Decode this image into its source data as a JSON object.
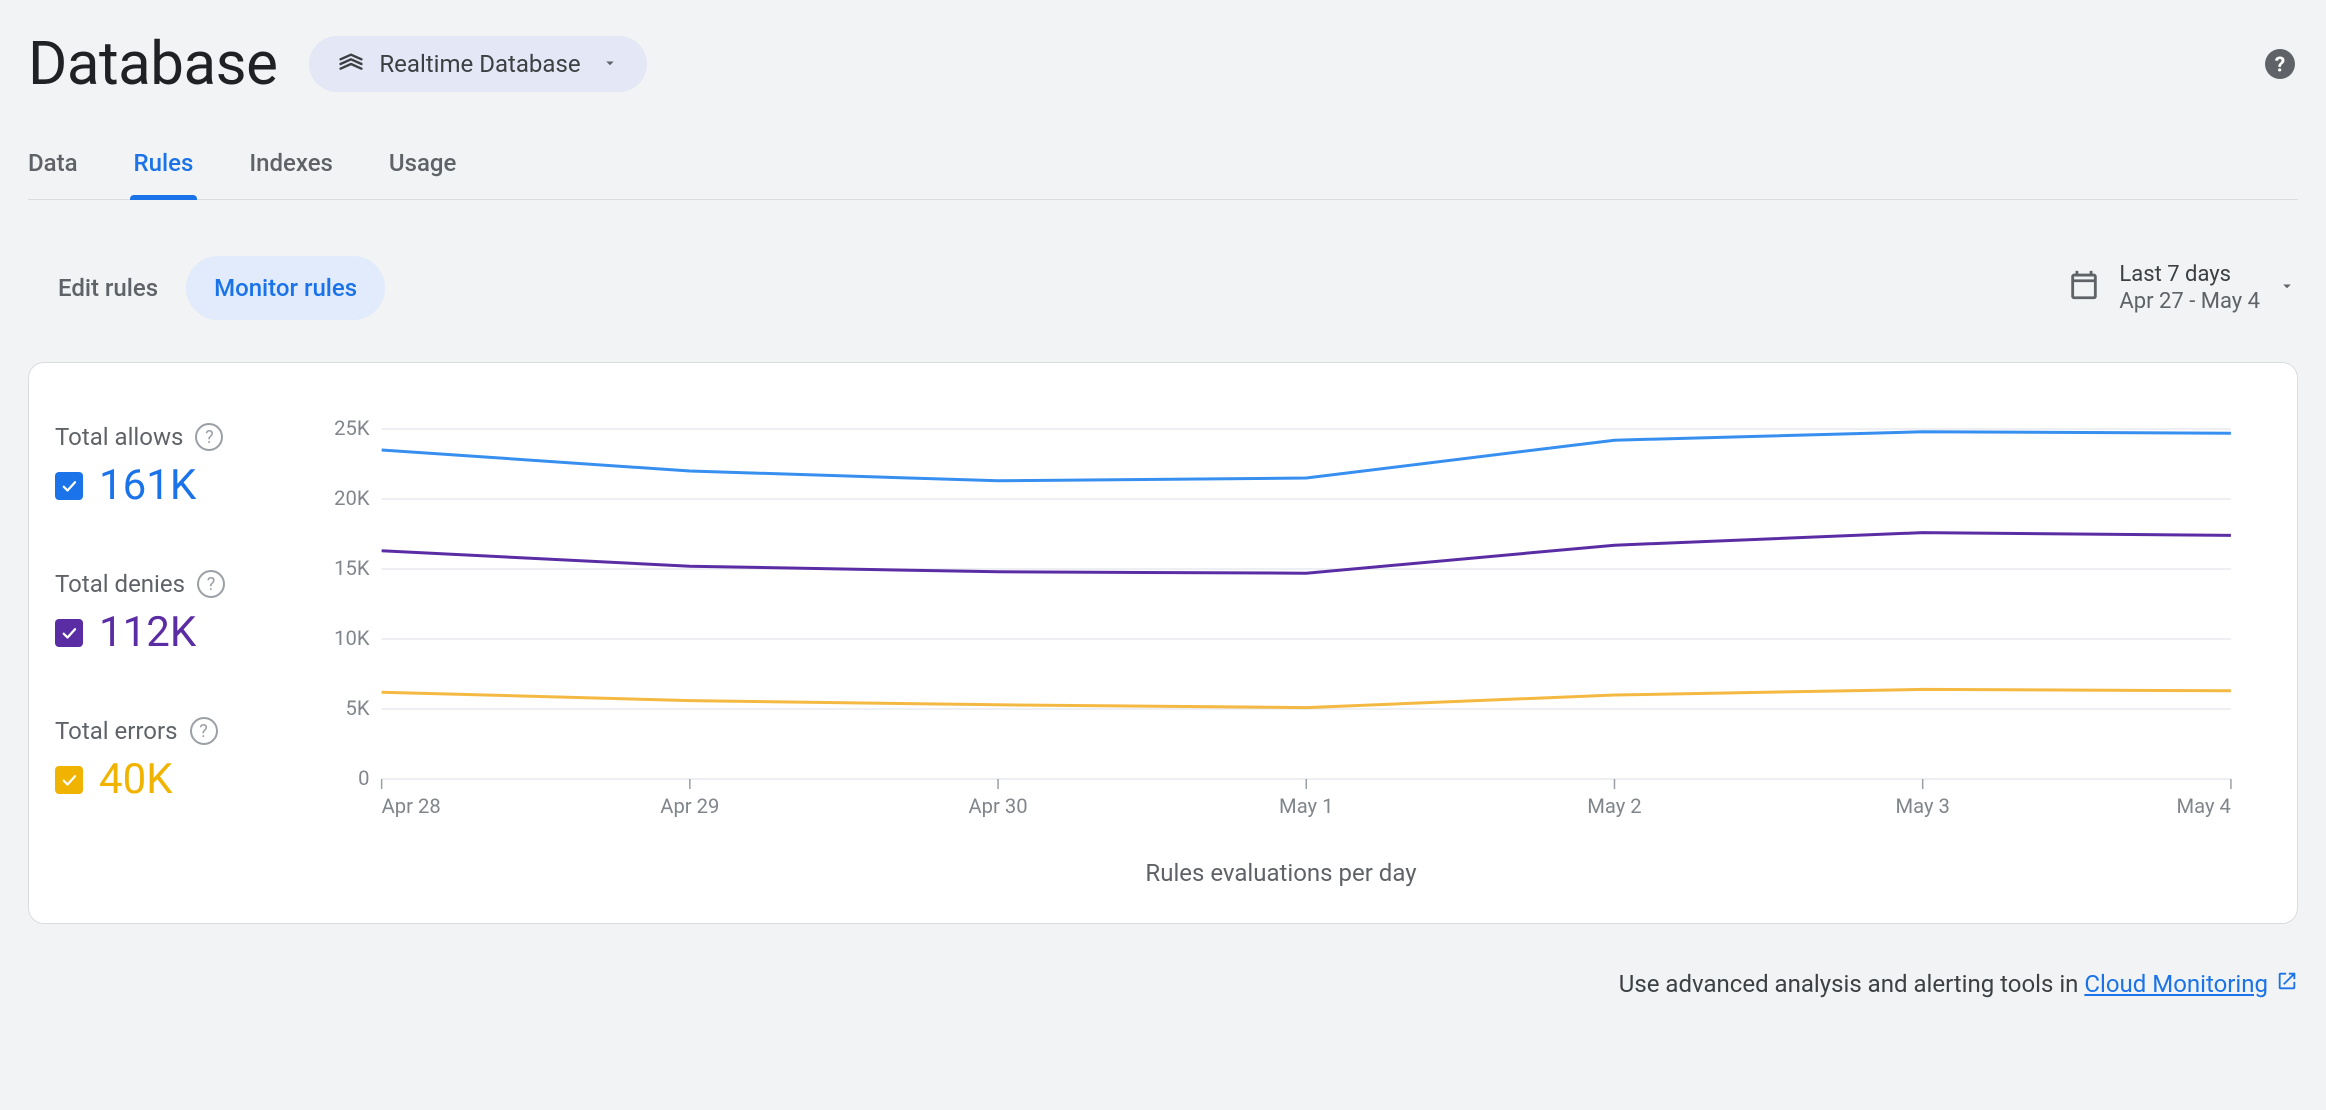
{
  "header": {
    "title": "Database",
    "selector_label": "Realtime Database"
  },
  "tabs": [
    "Data",
    "Rules",
    "Indexes",
    "Usage"
  ],
  "active_tab_index": 1,
  "subtabs": [
    "Edit rules",
    "Monitor rules"
  ],
  "active_subtab_index": 1,
  "date_range": {
    "label": "Last 7 days",
    "range": "Apr 27 - May 4"
  },
  "metrics": {
    "allows": {
      "label": "Total allows",
      "value": "161K",
      "color": "#1a73e8"
    },
    "denies": {
      "label": "Total denies",
      "value": "112K",
      "color": "#5b2da5"
    },
    "errors": {
      "label": "Total errors",
      "value": "40K",
      "color": "#f0b400"
    }
  },
  "chart_data": {
    "type": "line",
    "title": "Rules evaluations per day",
    "xlabel": "",
    "ylabel": "",
    "ylim": [
      0,
      25000
    ],
    "y_ticks": [
      0,
      5000,
      10000,
      15000,
      20000,
      25000
    ],
    "y_tick_labels": [
      "0",
      "5K",
      "10K",
      "15K",
      "20K",
      "25K"
    ],
    "categories": [
      "Apr 28",
      "Apr 29",
      "Apr 30",
      "May 1",
      "May 2",
      "May 3",
      "May 4"
    ],
    "series": [
      {
        "name": "allows",
        "values": [
          23500,
          22000,
          21300,
          21500,
          24200,
          24800,
          24700
        ]
      },
      {
        "name": "denies",
        "values": [
          16300,
          15200,
          14800,
          14700,
          16700,
          17600,
          17400
        ]
      },
      {
        "name": "errors",
        "values": [
          6200,
          5600,
          5300,
          5100,
          6000,
          6400,
          6300
        ]
      }
    ]
  },
  "footer": {
    "text": "Use advanced analysis and alerting tools in ",
    "link_label": "Cloud Monitoring"
  }
}
